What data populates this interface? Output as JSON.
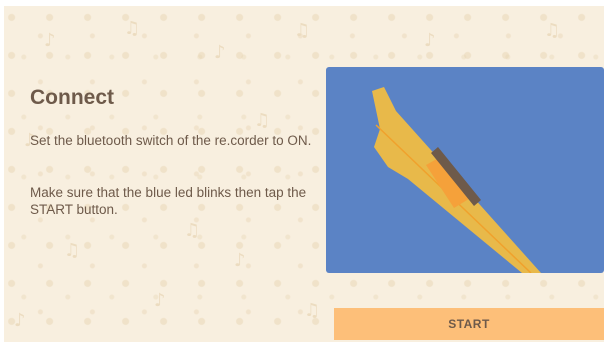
{
  "connect": {
    "title": "Connect",
    "instruction_1": "Set the bluetooth switch of the re.corder to ON.",
    "instruction_2": "Make sure that the blue led blinks then tap the START button."
  },
  "illustration": {
    "background_color": "#5b83c5",
    "device_color": "#e8b94a",
    "switch_color": "#6e5a4a",
    "led_color": "#f5a13a"
  },
  "start_button": {
    "label": "START",
    "color": "#fdbf79"
  }
}
